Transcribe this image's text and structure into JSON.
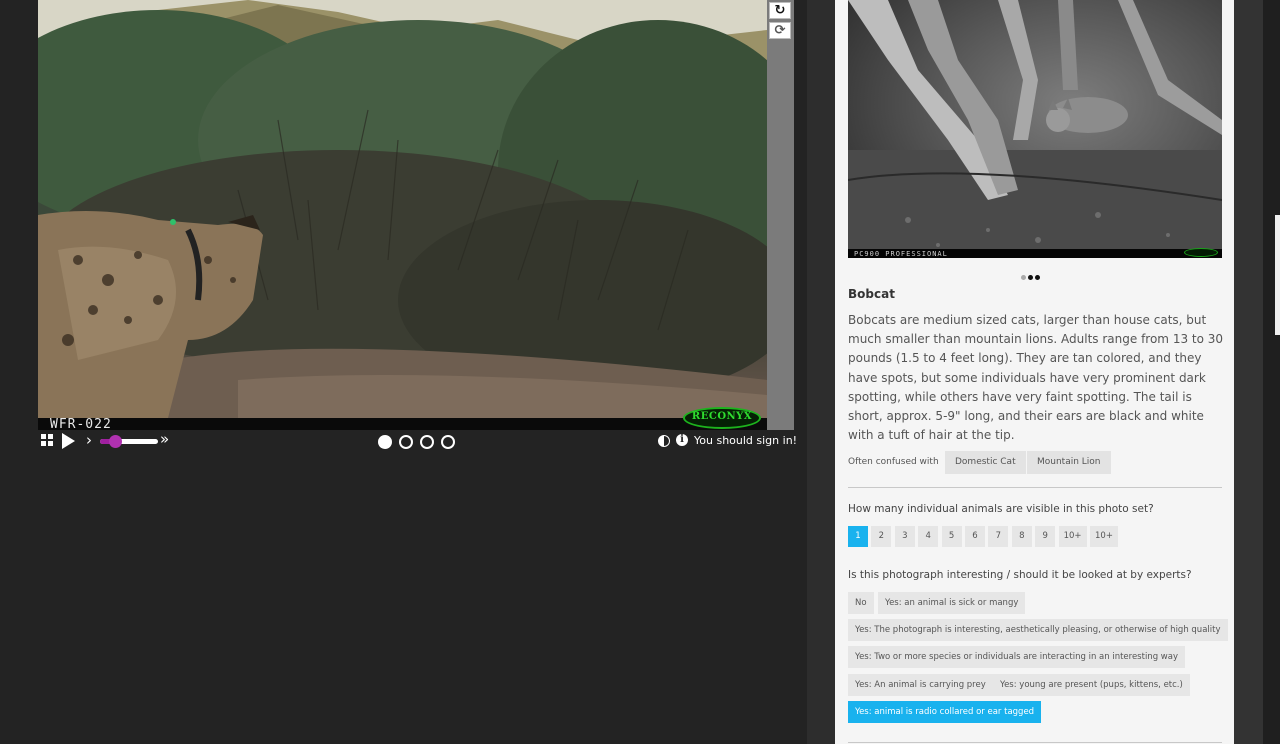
{
  "viewer": {
    "camera_id": "WFR-022",
    "brand": "RECONYX",
    "rail_buttons": {
      "reload_glyph": "↻",
      "refresh_glyph": "⟳"
    },
    "controls": {
      "slower_glyph": "›",
      "faster_glyph": "»",
      "speed_fraction": 0.25,
      "frame_count": 4,
      "active_frame": 1,
      "info_glyph": "i",
      "signin_text": "You should sign in!"
    }
  },
  "species": {
    "example_caption": "PC900 PROFESSIONAL",
    "example_dots": {
      "count": 3,
      "active": [
        2,
        3
      ]
    },
    "name": "Bobcat",
    "description": "Bobcats are medium sized cats, larger than house cats, but much smaller than mountain lions. Adults range from 13 to 30 pounds (1.5 to 4 feet long). They are tan colored, and they have spots, but some individuals have very prominent dark spotting, while others have very faint spotting. The tail is short, approx. 5-9\" long, and their ears are black and white with a tuft of hair at the tip.",
    "confused_label": "Often confused with",
    "confused_with": [
      "Domestic Cat",
      "Mountain Lion"
    ]
  },
  "questions": {
    "count_question": "How many individual animals are visible in this photo set?",
    "count_options": [
      "1",
      "2",
      "3",
      "4",
      "5",
      "6",
      "7",
      "8",
      "9",
      "10+",
      "10+"
    ],
    "count_selected": 0,
    "interesting_question": "Is this photograph interesting / should it be looked at by experts?",
    "interesting_options": [
      {
        "label": "No",
        "selected": false
      },
      {
        "label": "Yes: an animal is sick or mangy",
        "selected": false
      },
      {
        "label": "Yes: The photograph is interesting, aesthetically pleasing, or otherwise of high quality",
        "selected": false
      },
      {
        "label": "Yes: Two or more species or individuals are interacting in an interesting way",
        "selected": false
      },
      {
        "label": "Yes: An animal is carrying prey",
        "selected": false
      },
      {
        "label": "Yes: young are present (pups, kittens, etc.)",
        "selected": false
      },
      {
        "label": "Yes: animal is radio collared or ear tagged",
        "selected": true
      }
    ]
  },
  "colors": {
    "accent": "#19b2ee",
    "speed_slider": "#a020a0",
    "background": "#232323",
    "panel": "#f5f5f5"
  }
}
